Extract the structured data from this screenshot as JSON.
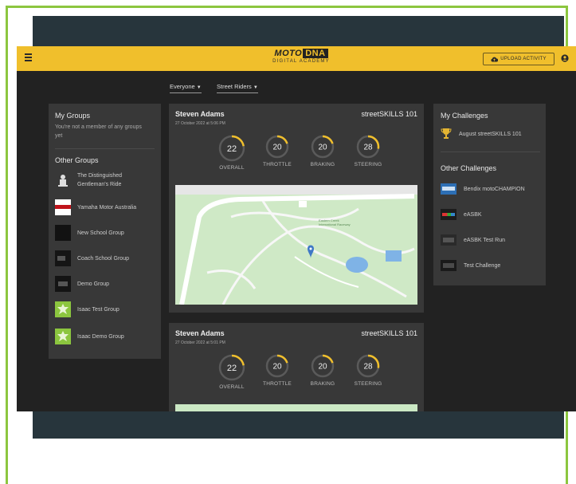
{
  "header": {
    "logo_main": "MOTO",
    "logo_dna": "DNA",
    "logo_sub": "DIGITAL ACADEMY",
    "upload_label": "UPLOAD ACTIVITY"
  },
  "filters": {
    "audience": "Everyone",
    "group": "Street Riders"
  },
  "left_panel": {
    "my_groups_title": "My Groups",
    "my_groups_empty": "You're not a member of any groups yet",
    "other_groups_title": "Other Groups",
    "groups": [
      {
        "label": "The Distinguished Gentleman's Ride"
      },
      {
        "label": "Yamaha Motor Australia"
      },
      {
        "label": "New School Group"
      },
      {
        "label": "Coach School Group"
      },
      {
        "label": "Demo Group"
      },
      {
        "label": "Isaac Test Group"
      },
      {
        "label": "Isaac Demo Group"
      }
    ]
  },
  "right_panel": {
    "my_challenges_title": "My Challenges",
    "my_challenges": [
      {
        "label": "August streetSKILLS 101"
      }
    ],
    "other_challenges_title": "Other Challenges",
    "other_challenges": [
      {
        "label": "Bendix motoCHAMPION"
      },
      {
        "label": "eASBK"
      },
      {
        "label": "eASBK Test Run"
      },
      {
        "label": "Test Challenge"
      }
    ]
  },
  "activities": [
    {
      "rider": "Steven Adams",
      "date": "27 October 2022 at 5:06 PM",
      "type": "streetSKILLS 101",
      "scores": [
        {
          "label": "OVERALL",
          "value": "22",
          "fraction": 0.22
        },
        {
          "label": "THROTTLE",
          "value": "20",
          "fraction": 0.2
        },
        {
          "label": "BRAKING",
          "value": "20",
          "fraction": 0.2
        },
        {
          "label": "STEERING",
          "value": "28",
          "fraction": 0.28
        }
      ],
      "map_label": "Eastern Creek International Raceway"
    },
    {
      "rider": "Steven Adams",
      "date": "27 October 2022 at 5:01 PM",
      "type": "streetSKILLS 101",
      "scores": [
        {
          "label": "OVERALL",
          "value": "22",
          "fraction": 0.22
        },
        {
          "label": "THROTTLE",
          "value": "20",
          "fraction": 0.2
        },
        {
          "label": "BRAKING",
          "value": "20",
          "fraction": 0.2
        },
        {
          "label": "STEERING",
          "value": "28",
          "fraction": 0.28
        }
      ]
    }
  ],
  "colors": {
    "accent": "#f0bf2c",
    "panel": "#383838",
    "background": "#222222",
    "outer_frame": "#27353c",
    "border_green": "#8cc63f"
  }
}
